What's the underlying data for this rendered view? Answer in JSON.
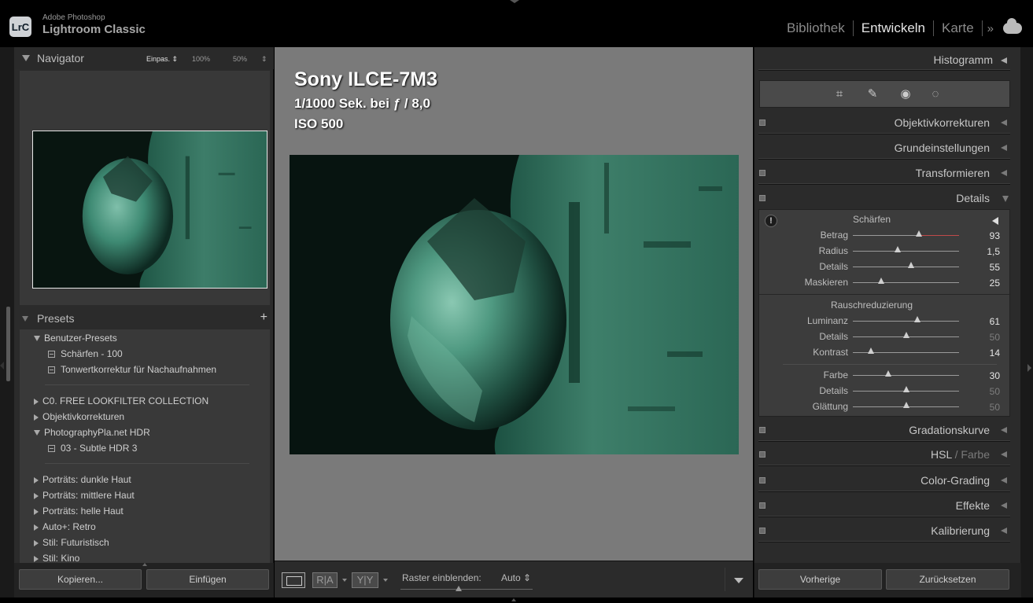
{
  "app": {
    "logo_text": "LrC",
    "brand_small": "Adobe Photoshop",
    "brand_big": "Lightroom Classic"
  },
  "modules": [
    {
      "label": "Bibliothek",
      "active": false
    },
    {
      "label": "Entwickeln",
      "active": true
    },
    {
      "label": "Karte",
      "active": false
    }
  ],
  "module_more": "»",
  "navigator": {
    "title": "Navigator",
    "zoom_fit": "Einpas. ⇕",
    "zoom_100": "100%",
    "zoom_50": "50%",
    "zoom_more": "⇕"
  },
  "presets": {
    "title": "Presets",
    "add": "+",
    "items": [
      {
        "kind": "group-open",
        "label": "Benutzer-Presets"
      },
      {
        "kind": "preset",
        "label": "Schärfen - 100"
      },
      {
        "kind": "preset",
        "label": "Tonwertkorrektur für Nachaufnahmen"
      },
      {
        "kind": "group",
        "label": "C0. FREE LOOKFILTER COLLECTION"
      },
      {
        "kind": "group",
        "label": "Objektivkorrekturen"
      },
      {
        "kind": "group-open",
        "label": "PhotographyPla.net HDR"
      },
      {
        "kind": "preset",
        "label": "03 - Subtle HDR 3"
      },
      {
        "kind": "group",
        "label": "Porträts: dunkle Haut"
      },
      {
        "kind": "group",
        "label": "Porträts: mittlere Haut"
      },
      {
        "kind": "group",
        "label": "Porträts: helle Haut"
      },
      {
        "kind": "group",
        "label": "Auto+: Retro"
      },
      {
        "kind": "group",
        "label": "Stil: Futuristisch"
      },
      {
        "kind": "group",
        "label": "Stil: Kino"
      }
    ]
  },
  "left_buttons": {
    "copy": "Kopieren...",
    "paste": "Einfügen"
  },
  "photo_info": {
    "camera": "Sony ILCE-7M3",
    "exposure": "1/1000 Sek. bei ƒ / 8,0",
    "iso": "ISO 500"
  },
  "toolbar": {
    "view_a": "R|A",
    "view_b": "Y|Y",
    "grid_label": "Raster einblenden:",
    "grid_value": "Auto ⇕"
  },
  "right": {
    "histogram": "Histogramm",
    "sections_top": [
      {
        "label": "Objektivkorrekturen",
        "switch": true
      },
      {
        "label": "Grundeinstellungen",
        "switch": false
      },
      {
        "label": "Transformieren",
        "switch": true
      },
      {
        "label": "Details",
        "switch": true
      }
    ],
    "details": {
      "warning": "!",
      "sharpen_title": "Schärfen",
      "sharpen": [
        {
          "label": "Betrag",
          "value": "93",
          "pos": 0.62,
          "dim": false
        },
        {
          "label": "Radius",
          "value": "1,5",
          "pos": 0.42,
          "dim": false
        },
        {
          "label": "Details",
          "value": "55",
          "pos": 0.55,
          "dim": false
        },
        {
          "label": "Maskieren",
          "value": "25",
          "pos": 0.27,
          "dim": false
        }
      ],
      "noise_title": "Rauschreduzierung",
      "noise": [
        {
          "label": "Luminanz",
          "value": "61",
          "pos": 0.61,
          "dim": false
        },
        {
          "label": "Details",
          "value": "50",
          "pos": 0.5,
          "dim": true
        },
        {
          "label": "Kontrast",
          "value": "14",
          "pos": 0.17,
          "dim": false
        }
      ],
      "color": [
        {
          "label": "Farbe",
          "value": "30",
          "pos": 0.33,
          "dim": false
        },
        {
          "label": "Details",
          "value": "50",
          "pos": 0.5,
          "dim": true
        },
        {
          "label": "Glättung",
          "value": "50",
          "pos": 0.5,
          "dim": true
        }
      ]
    },
    "sections_bottom": [
      {
        "label": "Gradationskurve"
      },
      {
        "label": "HSL",
        "label_dim": "Farbe"
      },
      {
        "label": "Color-Grading"
      },
      {
        "label": "Effekte"
      },
      {
        "label": "Kalibrierung"
      }
    ],
    "buttons": {
      "previous": "Vorherige",
      "reset": "Zurücksetzen"
    }
  },
  "colors": {
    "accent_red": "#c04a4a",
    "panel_bg": "#2b2b2b",
    "photo_teal": "#2e6b55"
  }
}
